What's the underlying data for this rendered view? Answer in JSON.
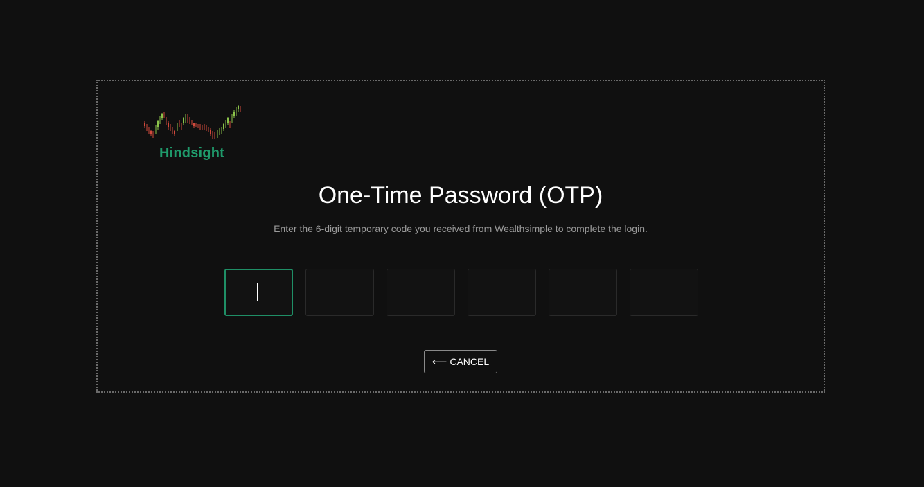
{
  "brand": {
    "name": "Hindsight",
    "color": "#1f9a6b",
    "logo_icon": "candlestick-chart-icon"
  },
  "heading": {
    "title": "One-Time Password (OTP)",
    "subtitle": "Enter the 6-digit temporary code you received from Wealthsimple to complete the login."
  },
  "otp": {
    "digits": [
      "",
      "",
      "",
      "",
      "",
      ""
    ],
    "active_index": 0,
    "accent_color": "#1f8f66"
  },
  "actions": {
    "cancel_arrow": "⟵",
    "cancel_label": "CANCEL"
  }
}
